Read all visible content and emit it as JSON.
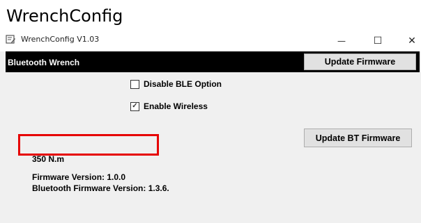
{
  "doc_heading": "WrenchConfig",
  "window": {
    "title": "WrenchConfig V1.03",
    "minimize_symbol": "—",
    "maximize_symbol": "☐",
    "close_symbol": "✕"
  },
  "header": {
    "title": "Bluetooth Wrench",
    "update_firmware_label": "Update Firmware"
  },
  "options": {
    "disable_ble_label": "Disable BLE Option",
    "disable_ble_checked": false,
    "enable_wireless_label": "Enable Wireless",
    "enable_wireless_checked": true,
    "check_mark": "✓"
  },
  "update_bt_firmware_label": "Update BT Firmware",
  "info": {
    "torque": "350 N.m",
    "firmware_version": "Firmware Version: 1.0.0",
    "bluetooth_firmware_version": "Bluetooth Firmware Version: 1.3.6."
  },
  "colors": {
    "highlight": "#e60000",
    "header_bg": "#000000"
  },
  "icons": {
    "app_icon": "app-icon"
  }
}
